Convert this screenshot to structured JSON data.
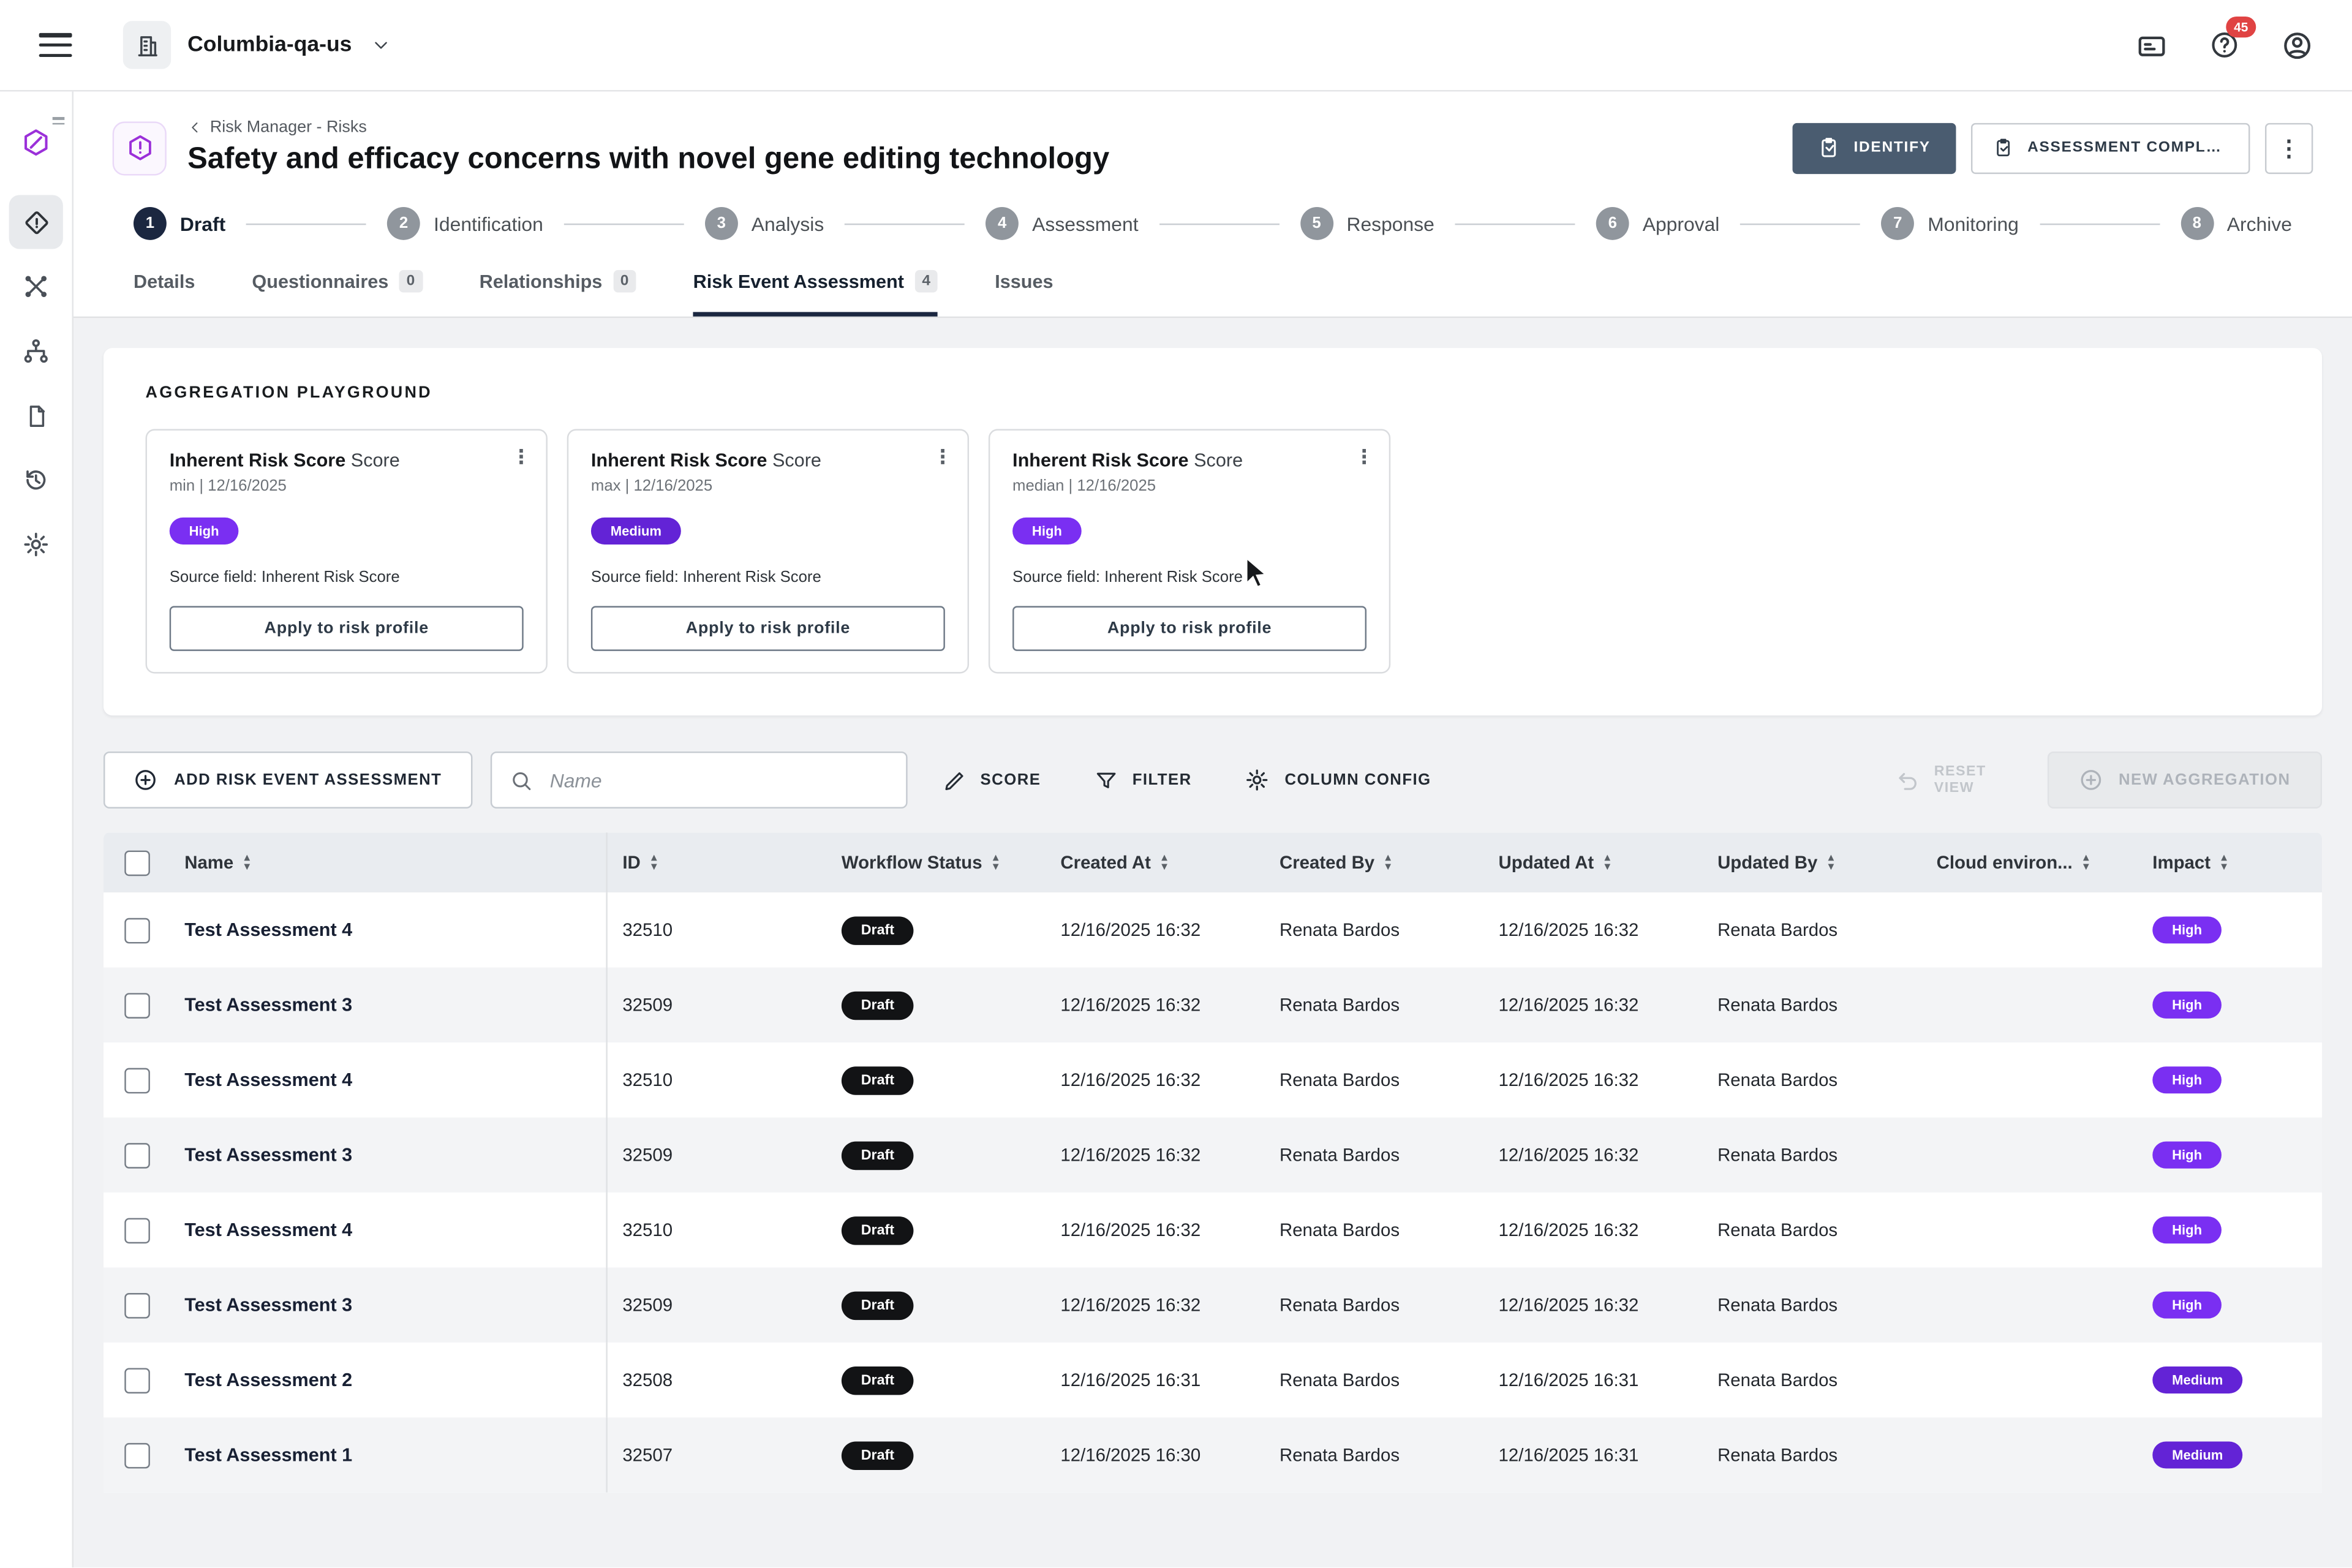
{
  "topbar": {
    "org": "Columbia-qa-us",
    "badge_count": "45"
  },
  "header": {
    "breadcrumb": "Risk Manager - Risks",
    "title": "Safety and efficacy concerns with novel gene editing technology",
    "identify_label": "IDENTIFY",
    "assessment_label": "ASSESSMENT COMPLETI..."
  },
  "stepper": [
    {
      "num": "1",
      "label": "Draft"
    },
    {
      "num": "2",
      "label": "Identification"
    },
    {
      "num": "3",
      "label": "Analysis"
    },
    {
      "num": "4",
      "label": "Assessment"
    },
    {
      "num": "5",
      "label": "Response"
    },
    {
      "num": "6",
      "label": "Approval"
    },
    {
      "num": "7",
      "label": "Monitoring"
    },
    {
      "num": "8",
      "label": "Archive"
    }
  ],
  "tabs": [
    {
      "label": "Details"
    },
    {
      "label": "Questionnaires",
      "count": "0"
    },
    {
      "label": "Relationships",
      "count": "0"
    },
    {
      "label": "Risk Event Assessment",
      "count": "4"
    },
    {
      "label": "Issues"
    }
  ],
  "aggregation": {
    "heading": "AGGREGATION PLAYGROUND",
    "cards": [
      {
        "title": "Inherent Risk Score",
        "title_suffix": "Score",
        "meta": "min | 12/16/2025",
        "level": "High",
        "source": "Source field: Inherent Risk Score",
        "action": "Apply to risk profile"
      },
      {
        "title": "Inherent Risk Score",
        "title_suffix": "Score",
        "meta": "max | 12/16/2025",
        "level": "Medium",
        "source": "Source field: Inherent Risk Score",
        "action": "Apply to risk profile"
      },
      {
        "title": "Inherent Risk Score",
        "title_suffix": "Score",
        "meta": "median | 12/16/2025",
        "level": "High",
        "source": "Source field: Inherent Risk Score",
        "action": "Apply to risk profile"
      }
    ]
  },
  "toolbar": {
    "add_label": "ADD RISK EVENT ASSESSMENT",
    "search_placeholder": "Name",
    "score_label": "SCORE",
    "filter_label": "FILTER",
    "column_config_label": "COLUMN CONFIG",
    "reset_view_label": "RESET VIEW",
    "new_aggregation_label": "NEW AGGREGATION"
  },
  "table": {
    "headers": [
      "Name",
      "ID",
      "Workflow Status",
      "Created At",
      "Created By",
      "Updated At",
      "Updated By",
      "Cloud environ...",
      "Impact"
    ],
    "rows": [
      {
        "name": "Test Assessment 4",
        "id": "32510",
        "status": "Draft",
        "created_at": "12/16/2025 16:32",
        "created_by": "Renata Bardos",
        "updated_at": "12/16/2025 16:32",
        "updated_by": "Renata Bardos",
        "cloud_env": "",
        "impact": "High"
      },
      {
        "name": "Test Assessment 3",
        "id": "32509",
        "status": "Draft",
        "created_at": "12/16/2025 16:32",
        "created_by": "Renata Bardos",
        "updated_at": "12/16/2025 16:32",
        "updated_by": "Renata Bardos",
        "cloud_env": "",
        "impact": "High"
      },
      {
        "name": "Test Assessment 4",
        "id": "32510",
        "status": "Draft",
        "created_at": "12/16/2025 16:32",
        "created_by": "Renata Bardos",
        "updated_at": "12/16/2025 16:32",
        "updated_by": "Renata Bardos",
        "cloud_env": "",
        "impact": "High"
      },
      {
        "name": "Test Assessment 3",
        "id": "32509",
        "status": "Draft",
        "created_at": "12/16/2025 16:32",
        "created_by": "Renata Bardos",
        "updated_at": "12/16/2025 16:32",
        "updated_by": "Renata Bardos",
        "cloud_env": "",
        "impact": "High"
      },
      {
        "name": "Test Assessment 4",
        "id": "32510",
        "status": "Draft",
        "created_at": "12/16/2025 16:32",
        "created_by": "Renata Bardos",
        "updated_at": "12/16/2025 16:32",
        "updated_by": "Renata Bardos",
        "cloud_env": "",
        "impact": "High"
      },
      {
        "name": "Test Assessment 3",
        "id": "32509",
        "status": "Draft",
        "created_at": "12/16/2025 16:32",
        "created_by": "Renata Bardos",
        "updated_at": "12/16/2025 16:32",
        "updated_by": "Renata Bardos",
        "cloud_env": "",
        "impact": "High"
      },
      {
        "name": "Test Assessment 2",
        "id": "32508",
        "status": "Draft",
        "created_at": "12/16/2025 16:31",
        "created_by": "Renata Bardos",
        "updated_at": "12/16/2025 16:31",
        "updated_by": "Renata Bardos",
        "cloud_env": "",
        "impact": "Medium"
      },
      {
        "name": "Test Assessment 1",
        "id": "32507",
        "status": "Draft",
        "created_at": "12/16/2025 16:30",
        "created_by": "Renata Bardos",
        "updated_at": "12/16/2025 16:31",
        "updated_by": "Renata Bardos",
        "cloud_env": "",
        "impact": "Medium"
      }
    ]
  },
  "colors": {
    "high": "#7a2ff2",
    "medium": "#6323d6",
    "draft": "#121315",
    "accent_purple": "#9b30d9",
    "identify_button": "#4a5c70"
  }
}
